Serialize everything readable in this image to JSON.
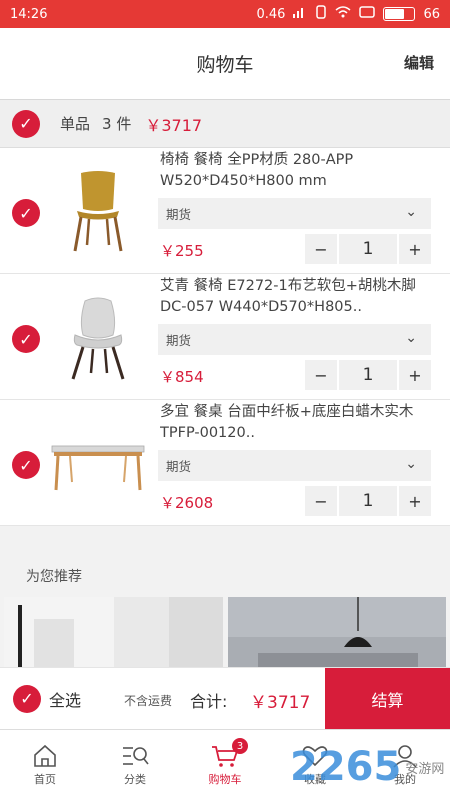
{
  "status_bar": {
    "time": "14:26",
    "network_speed": "0.46",
    "battery": "66",
    "battery_level": 0.66
  },
  "header": {
    "title": "购物车",
    "edit_label": "编辑"
  },
  "summary": {
    "label": "单品",
    "count": "3 件",
    "total": "￥3717"
  },
  "items": [
    {
      "title": "椅椅 餐椅 全PP材质 280-APP W520*D450*H800 mm",
      "spec": "期货",
      "price": "￥255",
      "quantity": "1",
      "minus": "−",
      "plus": "+"
    },
    {
      "title": "艾青 餐椅 E7272-1布艺软包+胡桃木脚 DC-057 W440*D570*H805..",
      "spec": "期货",
      "price": "￥854",
      "quantity": "1",
      "minus": "−",
      "plus": "+"
    },
    {
      "title": "多宜 餐桌 台面中纤板+底座白蜡木实木 TPFP-00120..",
      "spec": "期货",
      "price": "￥2608",
      "quantity": "1",
      "minus": "−",
      "plus": "+"
    }
  ],
  "recommend": {
    "title": "为您推荐"
  },
  "checkout": {
    "select_all": "全选",
    "shipping_note": "不含运费",
    "total_label": "合计:",
    "total": "￥3717",
    "settle": "结算"
  },
  "tabbar": {
    "tabs": [
      {
        "label": "首页",
        "icon": "home-icon"
      },
      {
        "label": "分类",
        "icon": "category-search-icon"
      },
      {
        "label": "购物车",
        "icon": "cart-icon",
        "badge": "3"
      },
      {
        "label": "收藏",
        "icon": "heart-icon"
      },
      {
        "label": "我的",
        "icon": "user-icon"
      }
    ]
  },
  "watermark": {
    "number": "2265",
    "text": "安游网"
  },
  "colors": {
    "accent": "#d71d3a",
    "status_bar": "#e53935"
  }
}
